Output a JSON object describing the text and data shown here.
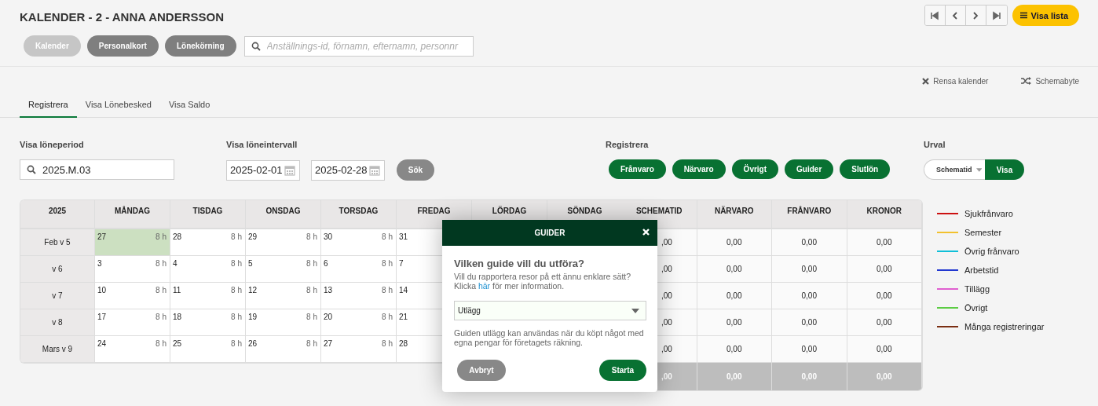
{
  "header": {
    "title": "KALENDER - 2 - ANNA ANDERSSON",
    "list_button": "Visa lista"
  },
  "modules": [
    {
      "label": "Kalender",
      "disabled": true
    },
    {
      "label": "Personalkort",
      "disabled": false
    },
    {
      "label": "Lönekörning",
      "disabled": false
    }
  ],
  "search": {
    "placeholder": "Anställnings-id, förnamn, efternamn, personnr"
  },
  "actions": [
    {
      "label": "Rensa kalender",
      "kind": "clear"
    },
    {
      "label": "Schemabyte",
      "kind": "swap"
    }
  ],
  "tabs": [
    {
      "label": "Registrera",
      "selected": true
    },
    {
      "label": "Visa Lönebesked",
      "selected": false
    },
    {
      "label": "Visa Saldo",
      "selected": false
    }
  ],
  "period": {
    "label": "Visa löneperiod",
    "value": "2025.M.03"
  },
  "interval": {
    "label": "Visa löneintervall",
    "from": "2025-02-01",
    "to": "2025-02-28",
    "button": "Sök"
  },
  "register": {
    "label": "Registrera",
    "buttons": [
      "Frånvaro",
      "Närvaro",
      "Övrigt",
      "Guider",
      "Slutlön"
    ]
  },
  "urval": {
    "label": "Urval",
    "select": "Schematid",
    "button": "Visa"
  },
  "calendar": {
    "year": "2025",
    "days": [
      "MÅNDAG",
      "TISDAG",
      "ONSDAG",
      "TORSDAG",
      "FREDAG",
      "LÖRDAG",
      "SÖNDAG"
    ],
    "weeks": [
      {
        "label": "Feb v 5",
        "cells": [
          {
            "date": "27",
            "hours": "8 h",
            "highlighted": true
          },
          {
            "date": "28",
            "hours": "8 h",
            "highlighted": false
          },
          {
            "date": "29",
            "hours": "8 h",
            "highlighted": false
          },
          {
            "date": "30",
            "hours": "8 h",
            "highlighted": false
          },
          {
            "date": "31",
            "highlighted": false
          }
        ]
      },
      {
        "label": "v 6",
        "cells": [
          {
            "date": "3",
            "hours": "8 h",
            "highlighted": false
          },
          {
            "date": "4",
            "hours": "8 h",
            "highlighted": false
          },
          {
            "date": "5",
            "hours": "8 h",
            "highlighted": false
          },
          {
            "date": "6",
            "hours": "8 h",
            "highlighted": false
          },
          {
            "date": "7",
            "highlighted": false
          }
        ]
      },
      {
        "label": "v 7",
        "cells": [
          {
            "date": "10",
            "hours": "8 h",
            "highlighted": false
          },
          {
            "date": "11",
            "hours": "8 h",
            "highlighted": false
          },
          {
            "date": "12",
            "hours": "8 h",
            "highlighted": false
          },
          {
            "date": "13",
            "hours": "8 h",
            "highlighted": false
          },
          {
            "date": "14",
            "highlighted": false
          }
        ]
      },
      {
        "label": "v 8",
        "cells": [
          {
            "date": "17",
            "hours": "8 h",
            "highlighted": false
          },
          {
            "date": "18",
            "hours": "8 h",
            "highlighted": false
          },
          {
            "date": "19",
            "hours": "8 h",
            "highlighted": false
          },
          {
            "date": "20",
            "hours": "8 h",
            "highlighted": false
          },
          {
            "date": "21",
            "highlighted": false
          }
        ]
      },
      {
        "label": "Mars v 9",
        "cells": [
          {
            "date": "24",
            "hours": "8 h",
            "highlighted": false
          },
          {
            "date": "25",
            "hours": "8 h",
            "highlighted": false
          },
          {
            "date": "26",
            "hours": "8 h",
            "highlighted": false
          },
          {
            "date": "27",
            "hours": "8 h",
            "highlighted": false
          },
          {
            "date": "28",
            "highlighted": false
          }
        ]
      }
    ]
  },
  "summary": {
    "columns": [
      "SCHEMATID",
      "NÄRVARO",
      "FRÅNVARO",
      "KRONOR"
    ],
    "rows": [
      [
        ",00",
        "0,00",
        "0,00",
        "0,00"
      ],
      [
        ",00",
        "0,00",
        "0,00",
        "0,00"
      ],
      [
        ",00",
        "0,00",
        "0,00",
        "0,00"
      ],
      [
        ",00",
        "0,00",
        "0,00",
        "0,00"
      ],
      [
        ",00",
        "0,00",
        "0,00",
        "0,00"
      ]
    ],
    "totals": [
      ",00",
      "0,00",
      "0,00",
      "0,00"
    ]
  },
  "legend": [
    {
      "label": "Sjukfrånvaro",
      "color": "#cc1111"
    },
    {
      "label": "Semester",
      "color": "#f2c12e"
    },
    {
      "label": "Övrig frånvaro",
      "color": "#10bfd8"
    },
    {
      "label": "Arbetstid",
      "color": "#2238d0"
    },
    {
      "label": "Tillägg",
      "color": "#e060d0"
    },
    {
      "label": "Övrigt",
      "color": "#5ccc44"
    },
    {
      "label": "Många registreringar",
      "color": "#7a2e12"
    }
  ],
  "dialog": {
    "title": "GUIDER",
    "question": "Vilken guide vill du utföra?",
    "info_before": "Vill du rapportera resor på ett ännu enklare sätt? Klicka ",
    "link": "här",
    "info_after": " för mer information.",
    "select": "Utlägg",
    "description": "Guiden utlägg kan användas när du köpt något med egna pengar för företagets räkning.",
    "cancel": "Avbryt",
    "start": "Starta"
  }
}
